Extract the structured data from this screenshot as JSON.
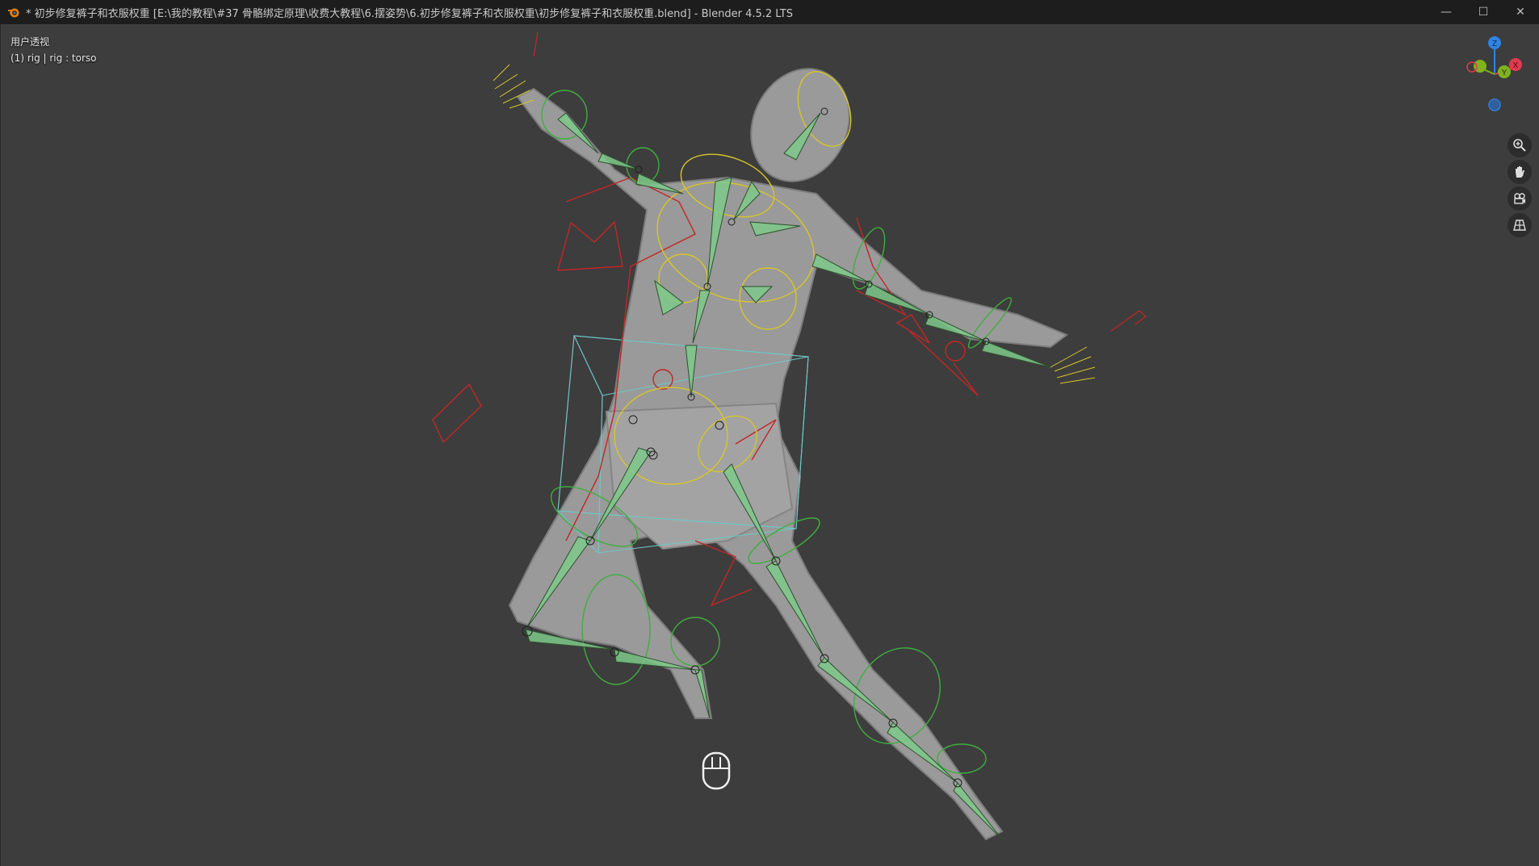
{
  "window": {
    "title": "* 初步修复裤子和衣服权重 [E:\\我的教程\\#37 骨骼绑定原理\\收费大教程\\6.摆姿势\\6.初步修复裤子和衣服权重\\初步修复裤子和衣服权重.blend] - Blender 4.5.2 LTS",
    "controls": {
      "minimize": "—",
      "maximize": "☐",
      "close": "✕"
    }
  },
  "viewport": {
    "view_name": "用户透视",
    "context_line": "(1) rig | rig : torso"
  },
  "gizmo": {
    "axes": {
      "z": "Z",
      "y": "Y",
      "x": "X"
    },
    "colors": {
      "x": "#e2394f",
      "y": "#7fb21f",
      "z": "#2f84e3"
    }
  },
  "nav_buttons": [
    "zoom-icon",
    "pan-hand-icon",
    "camera-icon",
    "perspective-grid-icon"
  ],
  "colors": {
    "viewport_bg": "#3d3d3d",
    "bone_fill": "#7ec98a",
    "bone_ctrl_green": "#3fae3f",
    "bone_ctrl_yellow": "#d6c62a",
    "bone_ctrl_red": "#c42626",
    "bone_ctrl_cyan": "#6fc7c7",
    "mesh": "#9c9c9c"
  }
}
